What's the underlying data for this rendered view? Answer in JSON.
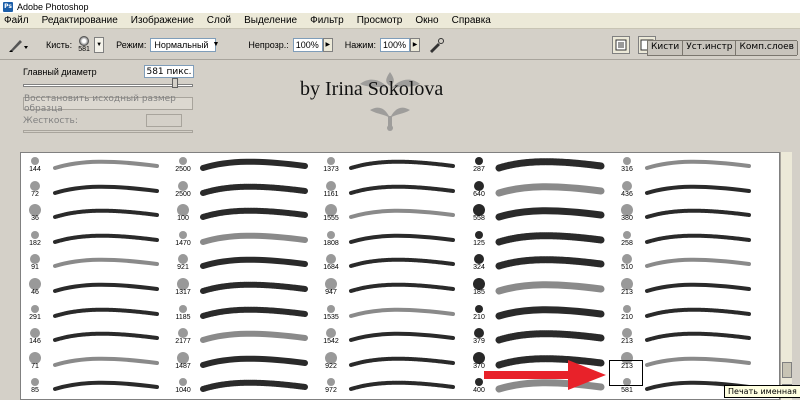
{
  "window": {
    "title": "Adobe Photoshop",
    "app_icon_label": "Ps"
  },
  "menubar": {
    "items": [
      "Файл",
      "Редактирование",
      "Изображение",
      "Слой",
      "Выделение",
      "Фильтр",
      "Просмотр",
      "Окно",
      "Справка"
    ]
  },
  "options": {
    "brush_label": "Кисть:",
    "brush_size": "581",
    "mode_label": "Режим:",
    "mode_value": "Нормальный",
    "opacity_label": "Непрозр.:",
    "opacity_value": "100%",
    "flow_label": "Нажим:",
    "flow_value": "100%"
  },
  "palette_well": {
    "tabs": [
      "Кисти",
      "Уст.инстр",
      "Комп.слоев"
    ]
  },
  "brush_panel": {
    "diameter_label": "Главный диаметр",
    "diameter_value": "581 пикс.",
    "diameter_fraction": 0.9,
    "restore_button": "Восстановить исходный размер образца",
    "hardness_label": "Жесткость:"
  },
  "watermark": "by Irina Sokolova",
  "brush_grid": {
    "columns": [
      {
        "numbers": [
          "144",
          "72",
          "36",
          "182",
          "91",
          "46",
          "291",
          "146",
          "71",
          "85"
        ]
      },
      {
        "numbers": [
          "2500",
          "2500",
          "100",
          "1470",
          "921",
          "1317",
          "1185",
          "2177",
          "1487",
          "1040"
        ]
      },
      {
        "numbers": [
          "1373",
          "1161",
          "1555",
          "1808",
          "1684",
          "947",
          "1535",
          "1542",
          "922",
          "972"
        ]
      },
      {
        "numbers": [
          "287",
          "640",
          "558",
          "125",
          "324",
          "185",
          "210",
          "379",
          "370",
          "400"
        ]
      },
      {
        "numbers": [
          "316",
          "436",
          "380",
          "258",
          "510",
          "213",
          "210",
          "213",
          "213",
          "581"
        ]
      }
    ],
    "selected_brush": "581",
    "tooltip": "Печать именная"
  },
  "colors": {
    "arrow": "#e8222a",
    "stroke": "#2a2a2a",
    "panel_bg": "#d4d0c8"
  }
}
